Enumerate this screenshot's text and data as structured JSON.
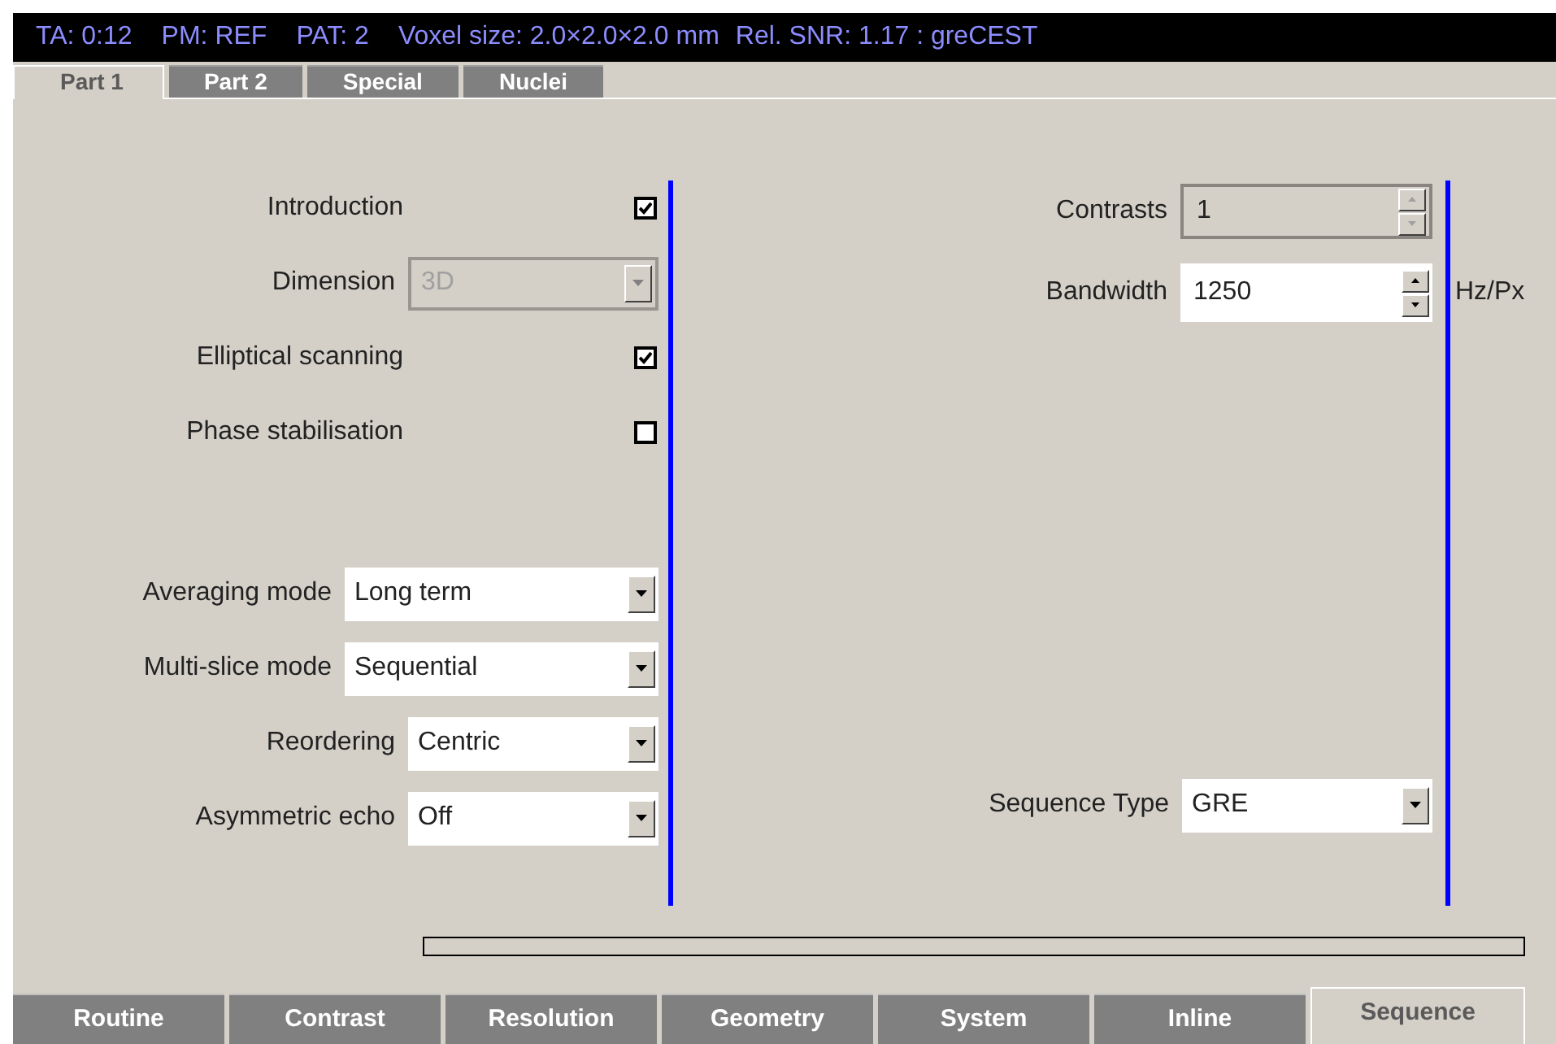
{
  "header": [
    "TA: 0:12",
    "PM: REF",
    "PAT: 2",
    "Voxel size: 2.0×2.0×2.0 mm",
    "Rel. SNR: 1.17 : greCEST"
  ],
  "tabs": [
    {
      "label": "Part 1",
      "selected": true
    },
    {
      "label": "Part 2",
      "selected": false
    },
    {
      "label": "Special",
      "selected": false
    },
    {
      "label": "Nuclei",
      "selected": false
    }
  ],
  "left_sections": [
    [
      {
        "kind": "checkbox",
        "label": "Introduction",
        "checked": true
      },
      {
        "kind": "combo",
        "label": "Dimension",
        "value": "3D",
        "disabled": true
      },
      {
        "kind": "checkbox",
        "label": "Elliptical scanning",
        "checked": true
      },
      {
        "kind": "checkbox",
        "label": "Phase stabilisation",
        "checked": false
      }
    ],
    [
      {
        "kind": "wide_combo",
        "label": "Averaging mode",
        "value": "Long term",
        "disabled": false
      },
      {
        "kind": "wide_combo",
        "label": "Multi-slice mode",
        "value": "Sequential",
        "disabled": false
      },
      {
        "kind": "combo",
        "label": "Reordering",
        "value": "Centric",
        "disabled": false
      },
      {
        "kind": "combo",
        "label": "Asymmetric echo",
        "value": "Off",
        "disabled": false
      }
    ]
  ],
  "right_sections": [
    [
      {
        "kind": "spin",
        "label": "Contrasts",
        "value": "1",
        "disabled": true
      },
      {
        "kind": "spin",
        "label": "Bandwidth",
        "value": "1250",
        "disabled": false,
        "unit": "Hz/Px"
      }
    ],
    [
      {
        "kind": "combo",
        "label": "Sequence Type",
        "value": "GRE",
        "disabled": false
      }
    ]
  ],
  "progress": {
    "level": 0
  },
  "bottom_tabs": [
    {
      "label": "Routine",
      "selected": false
    },
    {
      "label": "Contrast",
      "selected": false
    },
    {
      "label": "Resolution",
      "selected": false
    },
    {
      "label": "Geometry",
      "selected": false
    },
    {
      "label": "System",
      "selected": false
    },
    {
      "label": "Inline",
      "selected": false
    },
    {
      "label": "Sequence",
      "selected": true
    }
  ]
}
